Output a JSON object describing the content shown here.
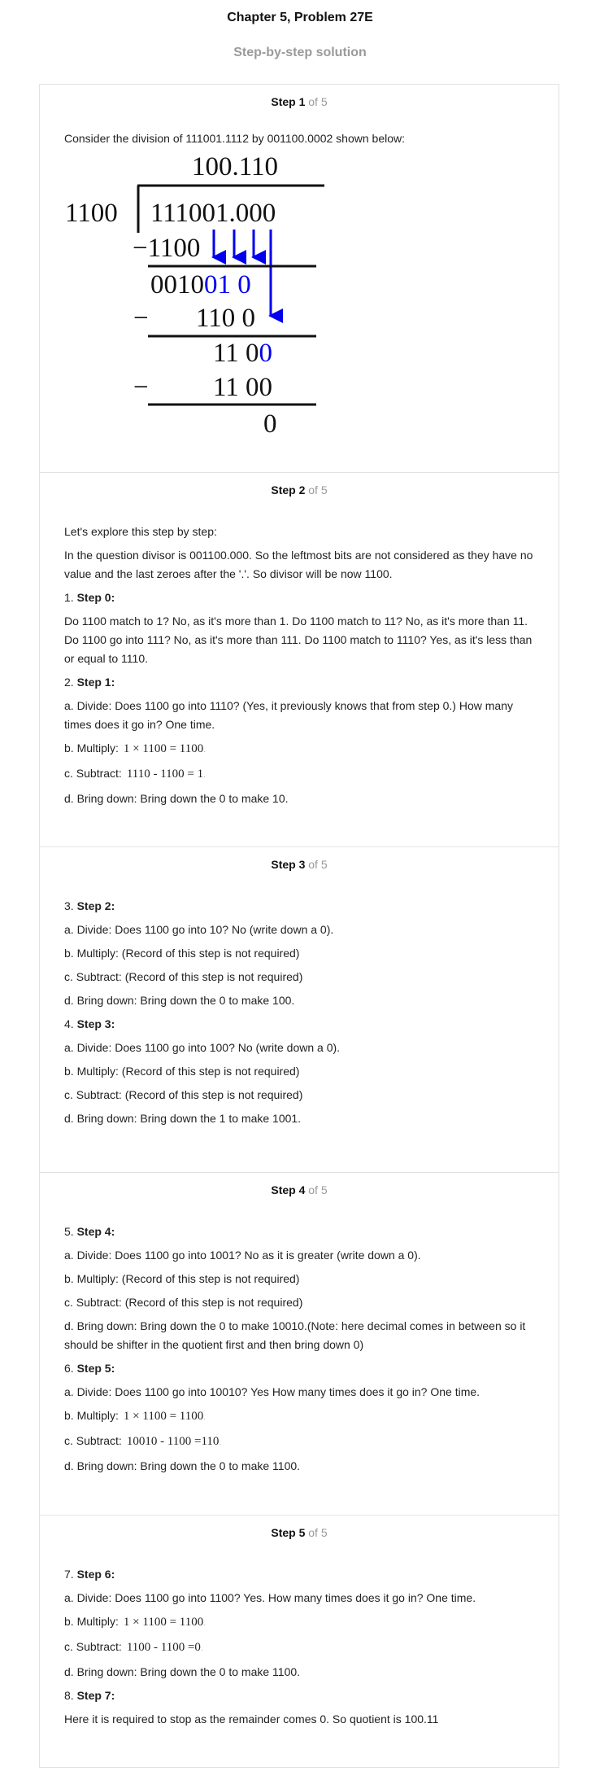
{
  "header": {
    "title": "Chapter 5, Problem 27E",
    "subtitle": "Step-by-step solution"
  },
  "step_of_label": "of 5",
  "steps": [
    {
      "label": "Step 1",
      "intro": "Consider the division of 111001.1112 by 001100.0002 shown below:",
      "figure": {
        "quotient": "100.110",
        "divisor": "1100",
        "dividend": "111001.000",
        "sub1": "−1100",
        "rem1_black": "0010",
        "rem1_blue": "01 0",
        "minus2": "−",
        "sub2": "110 0",
        "rem2_black": "11 0",
        "rem2_blue": "0",
        "minus3": "−",
        "sub3": "11 00",
        "final": "0"
      }
    },
    {
      "label": "Step 2",
      "p1": "Let's explore this step by step:",
      "p2": "In the question divisor is 001100.000. So the leftmost bits are not considered as they have no value and the last zeroes after the '.'. So divisor will be now 1100.",
      "s0_num": "1.",
      "s0_title": "Step 0:",
      "s0_text": "Do 1100 match to 1? No, as it's more than 1. Do 1100 match to 11? No, as it's more than 11. Do 1100 go into 111? No, as it's more than 111. Do 1100 match to 1110? Yes, as it's less than or equal to 1110.",
      "s1_num": "2.",
      "s1_title": "Step 1:",
      "a": "a. Divide: Does 1100 go into 1110? (Yes, it previously knows that from step 0.) How many times does it go in? One time.",
      "b_label": "b. Multiply:",
      "b_math": "1 × 1100 = 1100",
      "c_label": "c. Subtract:",
      "c_math": "1110 - 1100 = 1",
      "d": "d. Bring down: Bring down the 0 to make 10."
    },
    {
      "label": "Step 3",
      "s2_num": "3.",
      "s2_title": "Step 2:",
      "s2_a": "a. Divide: Does 1100 go into 10? No (write down a 0).",
      "s2_b": "b. Multiply: (Record of this step is not required)",
      "s2_c": "c. Subtract: (Record of this step is not required)",
      "s2_d": "d. Bring down: Bring down the 0 to make 100.",
      "s3_num": "4.",
      "s3_title": "Step 3:",
      "s3_a": "a. Divide: Does 1100 go into 100? No (write down a 0).",
      "s3_b": "b. Multiply: (Record of this step is not required)",
      "s3_c": "c. Subtract: (Record of this step is not required)",
      "s3_d": "d. Bring down: Bring down the 1 to make 1001."
    },
    {
      "label": "Step 4",
      "s4_num": "5.",
      "s4_title": "Step 4:",
      "s4_a": "a. Divide: Does 1100 go into 1001? No as it is greater (write down a 0).",
      "s4_b": "b. Multiply: (Record of this step is not required)",
      "s4_c": "c. Subtract: (Record of this step is not required)",
      "s4_d": "d. Bring down: Bring down the 0 to make 10010.(Note: here decimal comes in between so it should be shifter in the quotient first and then bring down 0)",
      "s5_num": "6.",
      "s5_title": "Step 5:",
      "s5_a": "a. Divide: Does 1100 go into 10010? Yes How many times does it go in? One time.",
      "s5_b_label": "b. Multiply:",
      "s5_b_math": "1 × 1100 = 1100",
      "s5_c_label": "c. Subtract:",
      "s5_c_math": "10010 - 1100 =110",
      "s5_d": "d. Bring down: Bring down the 0 to make 1100."
    },
    {
      "label": "Step 5",
      "s6_num": "7.",
      "s6_title": "Step 6:",
      "s6_a": "a. Divide: Does 1100 go into 1100? Yes. How many times does it go in? One time.",
      "s6_b_label": "b. Multiply:",
      "s6_b_math": "1 × 1100 = 1100",
      "s6_c_label": "c. Subtract:",
      "s6_c_math": "1100 - 1100 =0",
      "s6_d": "d. Bring down: Bring down the 0 to make 1100.",
      "s7_num": "8.",
      "s7_title": "Step 7:",
      "s7_text": "Here it is required to stop as the remainder comes 0. So quotient is 100.11"
    }
  ]
}
